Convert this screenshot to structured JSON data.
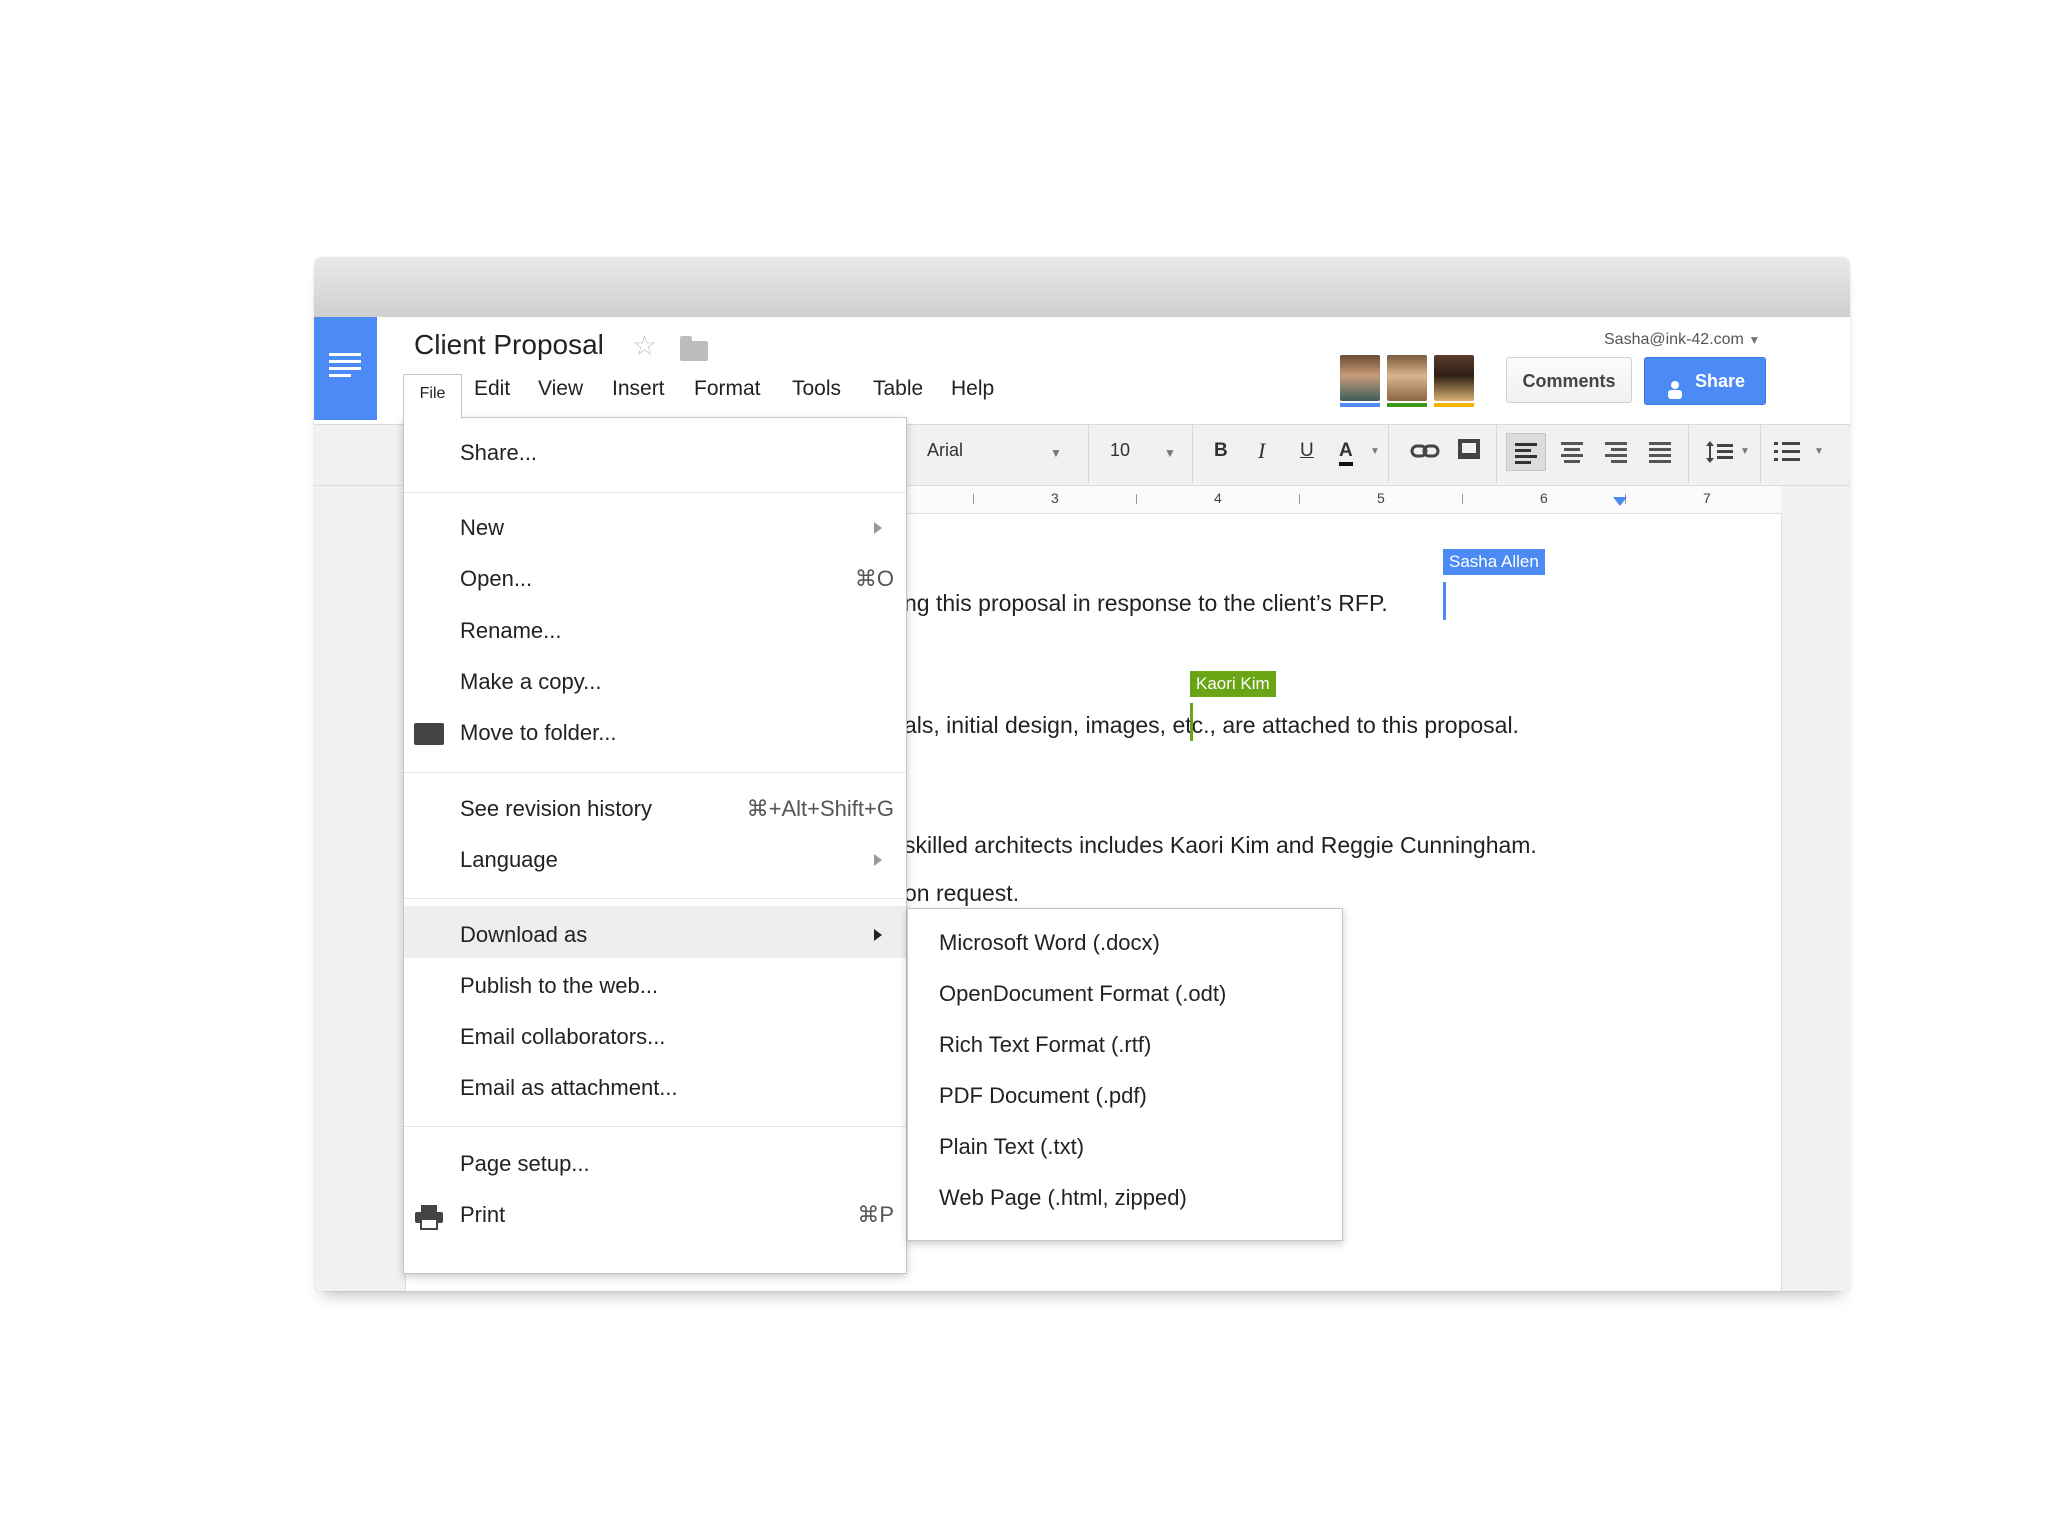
{
  "doc": {
    "title": "Client Proposal",
    "star_icon": "star-icon",
    "folder_icon": "folder-icon"
  },
  "menubar": {
    "items": [
      "File",
      "Edit",
      "View",
      "Insert",
      "Format",
      "Tools",
      "Table",
      "Help"
    ]
  },
  "account": {
    "email": "Sasha@ink-42.com",
    "collaborator_colors": [
      "#4c8bf5",
      "#3a9a17",
      "#f4b400"
    ]
  },
  "buttons": {
    "comments": "Comments",
    "share": "Share"
  },
  "toolbar": {
    "font": "Arial",
    "size": "10",
    "bold": "B",
    "italic": "I",
    "underline": "U",
    "text_color": "A"
  },
  "ruler": {
    "numbers": [
      "3",
      "4",
      "5",
      "6",
      "7"
    ]
  },
  "document": {
    "lines": [
      "ng this proposal in response to the client’s RFP.",
      "als, initial design, images, etc., are attached to this proposal.",
      "skilled architects includes Kaori Kim and Reggie Cunningham.",
      "on request."
    ],
    "cursors": [
      {
        "name": "Sasha Allen",
        "color": "#4c8bf5"
      },
      {
        "name": "Kaori Kim",
        "color": "#6aa516"
      }
    ]
  },
  "file_menu": {
    "share": "Share...",
    "new": "New",
    "open": "Open...",
    "open_shortcut": "⌘O",
    "rename": "Rename...",
    "make_copy": "Make a copy...",
    "move_to_folder": "Move to folder...",
    "revision_history": "See revision history",
    "revision_shortcut": "⌘+Alt+Shift+G",
    "language": "Language",
    "download_as": "Download as",
    "publish": "Publish to the web...",
    "email_collaborators": "Email collaborators...",
    "email_attachment": "Email as attachment...",
    "page_setup": "Page setup...",
    "print": "Print",
    "print_shortcut": "⌘P"
  },
  "download_submenu": {
    "items": [
      "Microsoft Word (.docx)",
      "OpenDocument Format (.odt)",
      "Rich Text Format (.rtf)",
      "PDF Document (.pdf)",
      "Plain Text (.txt)",
      "Web Page (.html, zipped)"
    ]
  }
}
